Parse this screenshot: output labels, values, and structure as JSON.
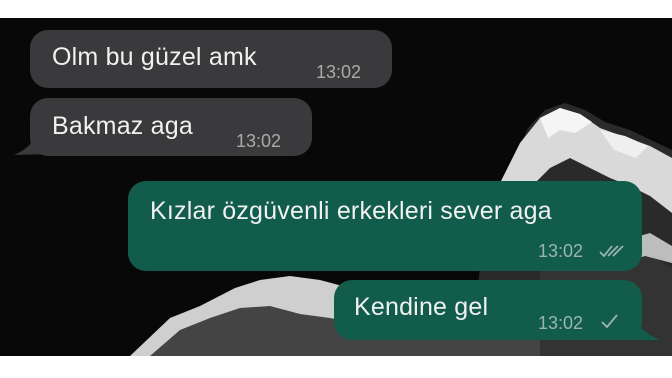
{
  "messages": [
    {
      "direction": "incoming",
      "text": "Olm bu güzel amk",
      "time": "13:02",
      "status": ""
    },
    {
      "direction": "incoming",
      "text": "Bakmaz aga",
      "time": "13:02",
      "status": ""
    },
    {
      "direction": "outgoing",
      "text": "Kızlar özgüvenli erkekleri sever aga",
      "time": "13:02",
      "status": "read"
    },
    {
      "direction": "outgoing",
      "text": "Kendine gel",
      "time": "13:02",
      "status": "sent"
    }
  ],
  "icons": {
    "read": "double-check-icon",
    "sent": "single-check-icon"
  },
  "colors": {
    "background": "#080808",
    "incoming_bubble": "#3a3a3c",
    "outgoing_bubble": "#115c4a"
  }
}
